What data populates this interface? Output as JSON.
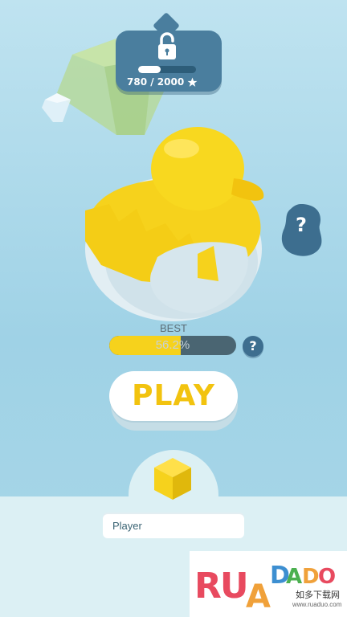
{
  "unlock": {
    "progress_text": "780 / 2000",
    "current": 780,
    "target": 2000,
    "star_icon": "star-icon",
    "lock_icon": "lock-icon"
  },
  "hint": {
    "label": "?"
  },
  "best": {
    "label": "BEST",
    "value_text": "56.2%",
    "percent": 56.2,
    "help_label": "?"
  },
  "play": {
    "label": "PLAY"
  },
  "player": {
    "name": "Player"
  },
  "watermark": {
    "brand": "RUAODAO",
    "sub": "如多下载网",
    "url": "www.ruaduo.com"
  },
  "colors": {
    "accent_yellow": "#f2c30f",
    "panel_blue": "#4a7e9e",
    "background": "#a9d7e8"
  }
}
